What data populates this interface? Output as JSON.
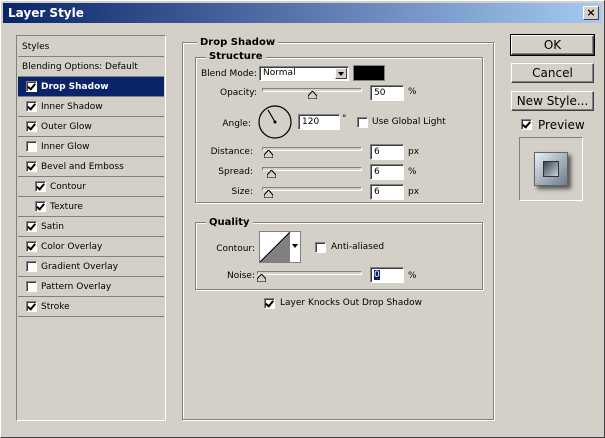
{
  "window": {
    "title": "Layer Style",
    "close_glyph": "×"
  },
  "styles_list": {
    "items": [
      {
        "label": "Styles",
        "type": "header"
      },
      {
        "label": "Blending Options: Default",
        "type": "header"
      },
      {
        "label": "Drop Shadow",
        "checked": true,
        "selected": true,
        "indent": 0
      },
      {
        "label": "Inner Shadow",
        "checked": true,
        "indent": 0
      },
      {
        "label": "Outer Glow",
        "checked": true,
        "indent": 0
      },
      {
        "label": "Inner Glow",
        "checked": false,
        "indent": 0
      },
      {
        "label": "Bevel and Emboss",
        "checked": true,
        "indent": 0
      },
      {
        "label": "Contour",
        "checked": true,
        "indent": 1
      },
      {
        "label": "Texture",
        "checked": true,
        "indent": 1
      },
      {
        "label": "Satin",
        "checked": true,
        "indent": 0
      },
      {
        "label": "Color Overlay",
        "checked": true,
        "indent": 0
      },
      {
        "label": "Gradient Overlay",
        "checked": false,
        "indent": 0
      },
      {
        "label": "Pattern Overlay",
        "checked": false,
        "indent": 0
      },
      {
        "label": "Stroke",
        "checked": true,
        "indent": 0
      }
    ]
  },
  "drop_shadow": {
    "title": "Drop Shadow",
    "structure": {
      "title": "Structure",
      "blend_mode_label": "Blend Mode:",
      "blend_mode_value": "Normal",
      "shadow_color": "#000000",
      "opacity_label": "Opacity:",
      "opacity_value": "50",
      "opacity_fraction": 0.5,
      "opacity_unit": "%",
      "angle_label": "Angle:",
      "angle_value": "120",
      "angle_degrees": 120,
      "angle_unit": "°",
      "use_global_light_label": "Use Global Light",
      "use_global_light_checked": false,
      "distance_label": "Distance:",
      "distance_value": "6",
      "distance_unit": "px",
      "distance_fraction": 0.02,
      "spread_label": "Spread:",
      "spread_value": "6",
      "spread_unit": "%",
      "spread_fraction": 0.06,
      "size_label": "Size:",
      "size_value": "6",
      "size_unit": "px",
      "size_fraction": 0.02
    },
    "quality": {
      "title": "Quality",
      "contour_label": "Contour:",
      "anti_aliased_label": "Anti-aliased",
      "anti_aliased_checked": false,
      "noise_label": "Noise:",
      "noise_value": "0",
      "noise_unit": "%",
      "noise_fraction": 0.0
    },
    "knocks_out_label": "Layer Knocks Out Drop Shadow",
    "knocks_out_checked": true
  },
  "buttons": {
    "ok": "OK",
    "cancel": "Cancel",
    "new_style": "New Style...",
    "preview_label": "Preview",
    "preview_checked": true
  }
}
